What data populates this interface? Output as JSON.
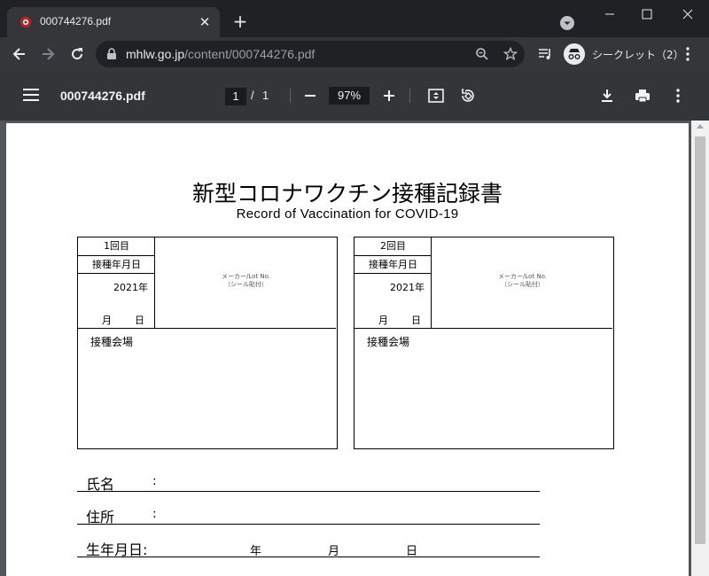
{
  "browser": {
    "tab_title": "000744276.pdf",
    "new_tab_symbol": "+",
    "url_host": "mhlw.go.jp",
    "url_path": "/content/000744276.pdf",
    "incognito_label": "シークレット（2）",
    "icons": [
      "favicon",
      "close-icon",
      "tab-search-icon",
      "back-icon",
      "forward-icon",
      "reload-icon",
      "lock-icon",
      "zoom-icon",
      "star-icon",
      "media-icon",
      "incognito-icon",
      "menu-icon"
    ]
  },
  "pdf_viewer": {
    "title": "000744276.pdf",
    "current_page": "1",
    "page_separator": "/",
    "total_pages": "1",
    "zoom": "97%",
    "icons": [
      "hamburger-icon",
      "zoom-out-icon",
      "zoom-in-icon",
      "fit-page-icon",
      "rotate-icon",
      "download-icon",
      "print-icon",
      "more-icon"
    ]
  },
  "document": {
    "title": "新型コロナワクチン接種記録書",
    "subtitle": "Record of Vaccination for COVID-19",
    "cards": [
      {
        "dose": "1回目",
        "date_label": "接種年月日",
        "year": "2021年",
        "month": "月",
        "day": "日",
        "maker_line1": "メーカー/Lot No.",
        "maker_line2": "（シール貼付）",
        "venue": "接種会場"
      },
      {
        "dose": "2回目",
        "date_label": "接種年月日",
        "year": "2021年",
        "month": "月",
        "day": "日",
        "maker_line1": "メーカー/Lot No.",
        "maker_line2": "（シール貼付）",
        "venue": "接種会場"
      }
    ],
    "name_label": "氏名",
    "address_label": "住所",
    "colon": ":",
    "birth_label": "生年月日:",
    "birth_year": "年",
    "birth_month": "月",
    "birth_day": "日"
  }
}
